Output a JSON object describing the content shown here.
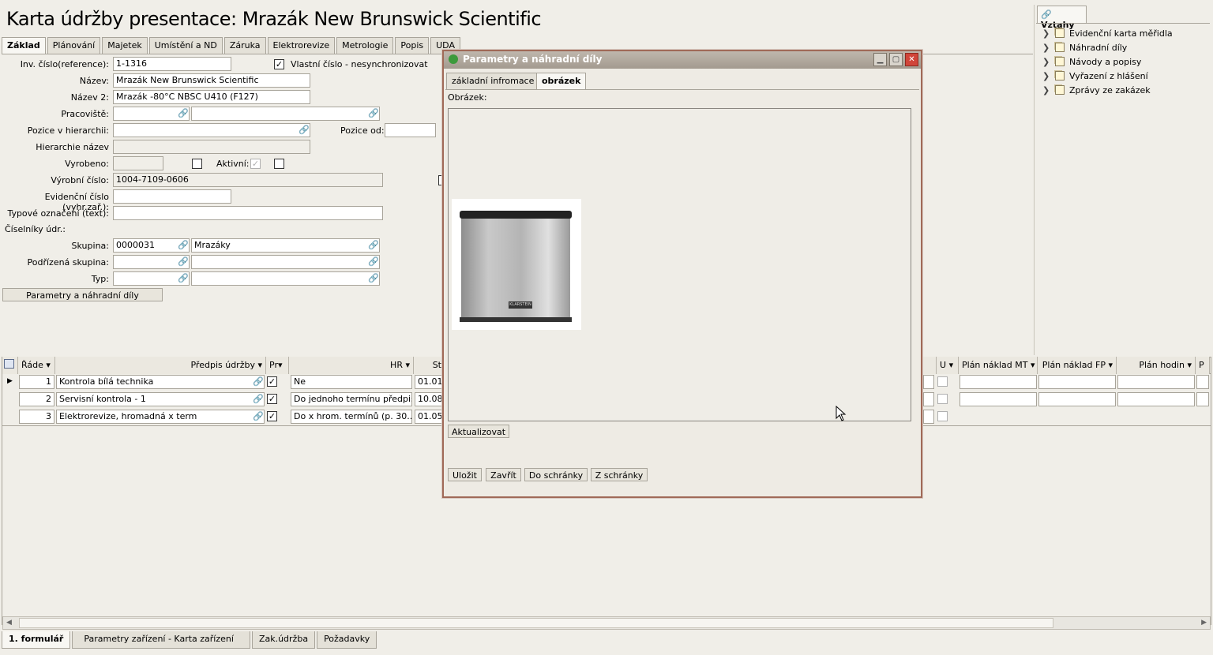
{
  "title": "Karta údržby presentace: Mrazák New Brunswick Scientific",
  "tabs": [
    "Základ",
    "Plánování",
    "Majetek",
    "Umístění a ND",
    "Záruka",
    "Elektrorevize",
    "Metrologie",
    "Popis",
    "UDA"
  ],
  "form": {
    "inv_label": "Inv. číslo(reference):",
    "inv_value": "1-1316",
    "own_number_label": "Vlastní číslo - nesynchronizovat",
    "nazev_label": "Název:",
    "nazev_value": "Mrazák New Brunswick Scientific",
    "nazev2_label": "Název 2:",
    "nazev2_value": "Mrazák -80°C NBSC U410 (F127)",
    "pracoviste_label": "Pracoviště:",
    "pozice_label": "Pozice v hierarchii:",
    "pozice_od_label": "Pozice od:",
    "hierarchie_label": "Hierarchie název",
    "vyrobeno_label": "Vyrobeno:",
    "aktivni_label": "Aktivní:",
    "vyrobni_label": "Výrobní číslo:",
    "vyrobni_value": "1004-7109-0606",
    "evidencni_label": "Evidenční číslo (vyhr.zař.):",
    "typove_label": "Typové označení (text):",
    "ciselniky_label": "Číselníky údr.:",
    "skupina_label": "Skupina:",
    "skupina_code": "0000031",
    "skupina_name": "Mrazáky",
    "podrizena_label": "Podřízená skupina:",
    "typ_label": "Typ:",
    "params_button": "Parametry a náhradní díly"
  },
  "relations": {
    "tab": "Vztahy",
    "items": [
      "Evidenční karta měřidla",
      "Náhradní díly",
      "Návody a popisy",
      "Vyřazení z hlášení",
      "Zprávy ze zakázek"
    ]
  },
  "grid": {
    "headers": {
      "rade": "Řáde",
      "predpis": "Předpis údržby",
      "pr": "Pr",
      "hr": "HR",
      "st": "St",
      "u": "U",
      "plan_mt": "Plán náklad MT",
      "plan_fp": "Plán náklad FP",
      "plan_hodin": "Plán hodin",
      "p": "P"
    },
    "rows": [
      {
        "num": "1",
        "predpis": "Kontrola bílá technika",
        "hr": "Ne",
        "st": "01.01."
      },
      {
        "num": "2",
        "predpis": "Servisní kontrola - 1",
        "hr": "Do jednoho termínu předpisu",
        "st": "10.08."
      },
      {
        "num": "3",
        "predpis": "Elektrorevize, hromadná x term",
        "hr": "Do x hrom. termínů (p. 30...",
        "st": "01.05."
      }
    ]
  },
  "bottom_tabs": [
    "1. formulář",
    "Parametry zařízení - Karta zařízení",
    "Zak.údržba",
    "Požadavky"
  ],
  "dialog": {
    "title": "Parametry a náhradní díly",
    "tabs": [
      "základní infromace",
      "obrázek"
    ],
    "image_label": "Obrázek:",
    "refresh_button": "Aktualizovat",
    "buttons": [
      "Uložit",
      "Zavřít",
      "Do schránky",
      "Z schránky"
    ],
    "brand_text": "KLARSTEIN"
  },
  "colors": {
    "background": "#f0eee8",
    "dialog_border": "#a06a58",
    "close_button": "#d0453a"
  }
}
